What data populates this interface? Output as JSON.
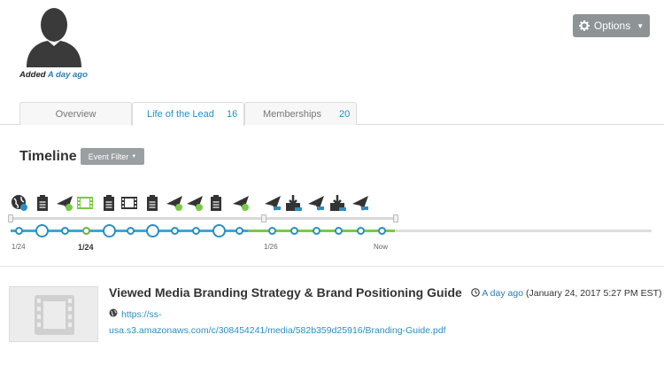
{
  "profile": {
    "added_prefix": "Added",
    "added_ago": "A day ago"
  },
  "options": {
    "label": "Options"
  },
  "tabs": [
    {
      "label": "Overview",
      "count": ""
    },
    {
      "label": "Life of the Lead",
      "count": "16"
    },
    {
      "label": "Memberships",
      "count": "20"
    }
  ],
  "timeline": {
    "title": "Timeline",
    "filter_label": "Event Filter",
    "tick_labels": [
      "1/24",
      "1/24",
      "1/26",
      "Now"
    ]
  },
  "event": {
    "title": "Viewed Media Branding Strategy & Brand Positioning Guide",
    "time_ago": "A day ago",
    "time_full": "(January 24, 2017 5:27 PM EST)",
    "url_line1": "https://ss-",
    "url_line2": "usa.s3.amazonaws.com/c/308454241/media/582b359d25916/Branding-Guide.pdf"
  },
  "colors": {
    "accent": "#2a8fc0",
    "green": "#7ac943",
    "button_gray": "#8e9496"
  },
  "icons": [
    "user-silhouette-icon",
    "gear-icon",
    "globe-icon",
    "clipboard-icon",
    "paper-plane-icon",
    "film-icon",
    "download-icon",
    "clock-icon"
  ]
}
